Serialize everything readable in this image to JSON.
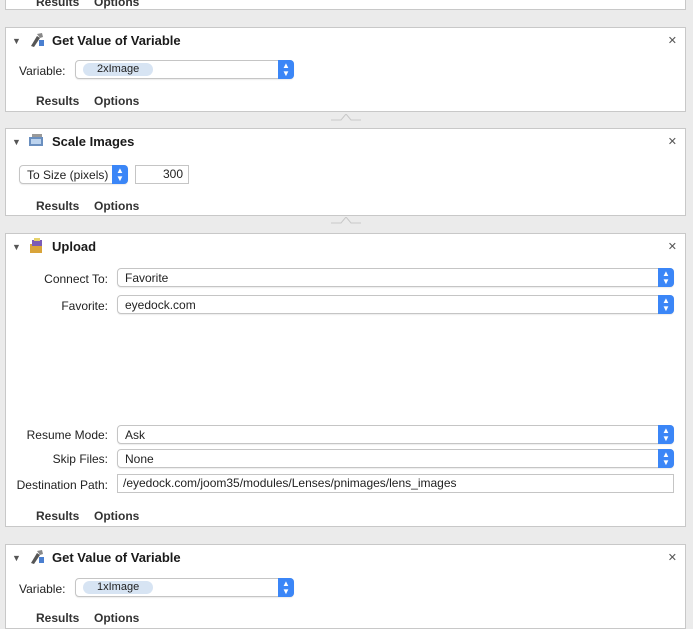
{
  "top_panel": {
    "tabs": [
      "Results",
      "Options"
    ]
  },
  "actions": [
    {
      "title": "Get Value of Variable",
      "icon": "variable-icon",
      "variable_label": "Variable:",
      "variable_value": "2xImage",
      "tabs": [
        "Results",
        "Options"
      ]
    },
    {
      "title": "Scale Images",
      "icon": "scale-images-icon",
      "scale_mode": "To Size (pixels)",
      "scale_value": "300",
      "tabs": [
        "Results",
        "Options"
      ]
    },
    {
      "title": "Upload",
      "icon": "upload-icon",
      "connect_to_label": "Connect To:",
      "connect_to_value": "Favorite",
      "favorite_label": "Favorite:",
      "favorite_value": "eyedock.com",
      "resume_mode_label": "Resume Mode:",
      "resume_mode_value": "Ask",
      "skip_files_label": "Skip Files:",
      "skip_files_value": "None",
      "destination_label": "Destination Path:",
      "destination_value": "/eyedock.com/joom35/modules/Lenses/pnimages/lens_images",
      "tabs": [
        "Results",
        "Options"
      ]
    },
    {
      "title": "Get Value of Variable",
      "icon": "variable-icon",
      "variable_label": "Variable:",
      "variable_value": "1xImage",
      "tabs": [
        "Results",
        "Options"
      ]
    }
  ],
  "glyphs": {
    "collapse": "▼",
    "close": "✕",
    "updown": "▲▼"
  },
  "colors": {
    "accent": "#3b86f7",
    "variable_pill": "#d7e4f3",
    "background": "#ebebeb"
  }
}
